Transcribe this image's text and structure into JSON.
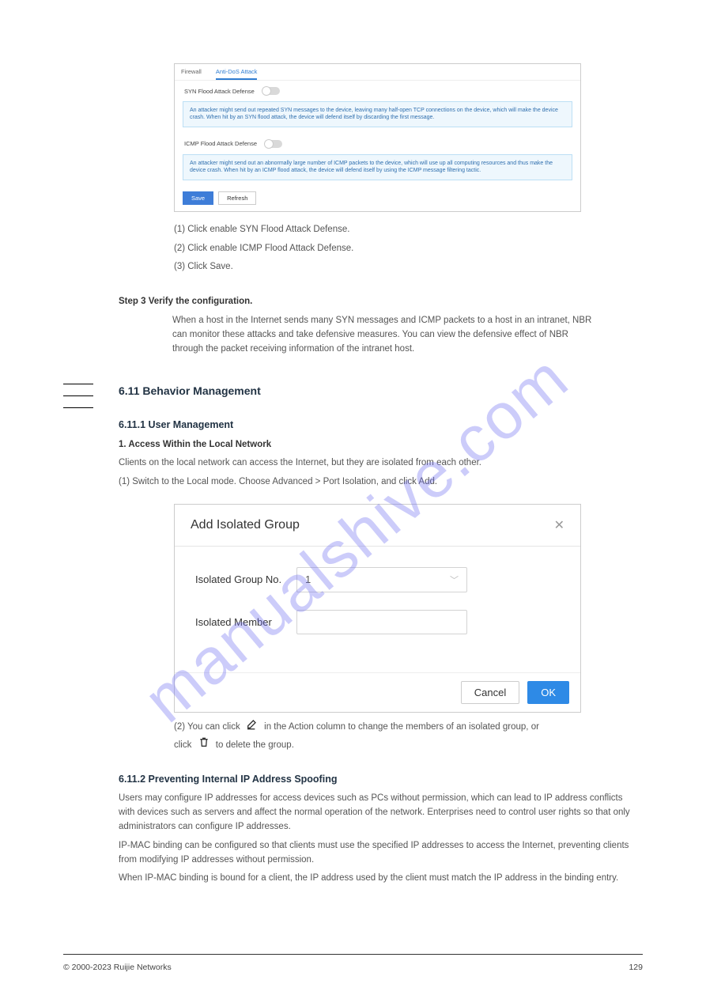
{
  "watermark": "manualshive.com",
  "screenshot1": {
    "tabs": {
      "firewall": "Firewall",
      "antidos": "Anti-DoS Attack"
    },
    "row1_label": "SYN Flood Attack Defense",
    "info1": "An attacker might send out repeated SYN messages to the device, leaving many half-open TCP connections on the device, which will make the device crash. When hit by an SYN flood attack, the device will defend itself by discarding the first message.",
    "row2_label": "ICMP Flood Attack Defense",
    "info2": "An attacker might send out an abnormally large number of ICMP packets to the device, which will use up all computing resources and thus make the device crash. When hit by an ICMP flood attack, the device will defend itself by using the ICMP message filtering tactic.",
    "save": "Save",
    "refresh": "Refresh"
  },
  "text": {
    "p1": "(1) Click enable SYN Flood Attack Defense.",
    "p2": "(2) Click enable ICMP Flood Attack Defense.",
    "p3": "(3) Click Save.",
    "step3": "Step 3     Verify the configuration.",
    "step3_body": "When a host in the Internet sends many SYN messages and ICMP packets to a host in an intranet, NBR can monitor these attacks and take defensive measures. You can view the defensive effect of NBR through the packet receiving information of the intranet host.",
    "h2": "6.11   Behavior Management",
    "h3_1": "6.11.1  User Management",
    "h3_1_sub": "1. Access Within the Local Network",
    "p_sub1": "Clients on the local network can access the Internet, but they are isolated from each other.",
    "p_sub2": "(1) Switch to the Local mode. Choose Advanced > Port Isolation, and click Add.",
    "dialog": {
      "title": "Add Isolated Group",
      "label1": "Isolated Group No.",
      "value1": "1",
      "label2": "Isolated Member",
      "cancel": "Cancel",
      "ok": "OK"
    },
    "after_dialog_1_a": "(2) You can click",
    "after_dialog_1_b": "in the Action column to change the members of an isolated group, or",
    "after_dialog_2_a": "click",
    "after_dialog_2_b": "to delete the group.",
    "h3_2": "6.11.2  Preventing Internal IP Address Spoofing",
    "p_spoof1": "Users may configure IP addresses for access devices such as PCs without permission, which can lead to IP address conflicts with devices such as servers and affect the normal operation of the network. Enterprises need to control user rights so that only administrators can configure IP addresses.",
    "p_spoof2": "IP-MAC binding can be configured so that clients must use the specified IP addresses to access the Internet, preventing clients from modifying IP addresses without permission.",
    "p_spoof3": "When IP-MAC binding is bound for a client, the IP address used by the client must match the IP address in the binding entry."
  },
  "footer_left": "© 2000-2023 Ruijie Networks",
  "footer_right": "129"
}
